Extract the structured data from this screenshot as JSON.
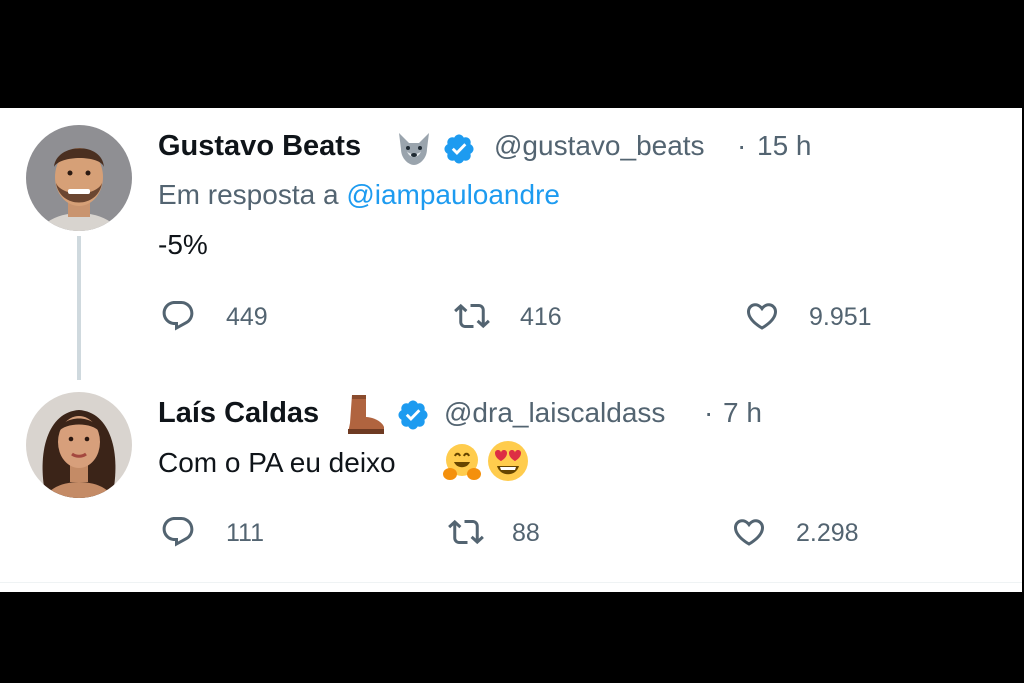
{
  "tweets": [
    {
      "author_name": "Gustavo Beats",
      "name_emoji_icon": "wolf-emoji",
      "verified_icon": "verified-badge-icon",
      "handle": "@gustavo_beats",
      "separator": "·",
      "time": "15 h",
      "reply_prefix": "Em resposta a ",
      "reply_mention": "@iampauloandre",
      "text": "-5%",
      "replies": "449",
      "retweets": "416",
      "likes": "9.951"
    },
    {
      "author_name": "Laís Caldas",
      "name_emoji_icon": "boot-emoji",
      "verified_icon": "verified-badge-icon",
      "handle": "@dra_laiscaldass",
      "separator": "·",
      "time": "7 h",
      "text": "Com o PA eu deixo",
      "text_emojis": [
        "hugging-face-emoji",
        "heart-eyes-emoji"
      ],
      "replies": "111",
      "retweets": "88",
      "likes": "2.298"
    }
  ],
  "colors": {
    "text_primary": "#0f1419",
    "text_secondary": "#536471",
    "accent": "#1d9bf0",
    "thread_line": "#cfd9de"
  }
}
